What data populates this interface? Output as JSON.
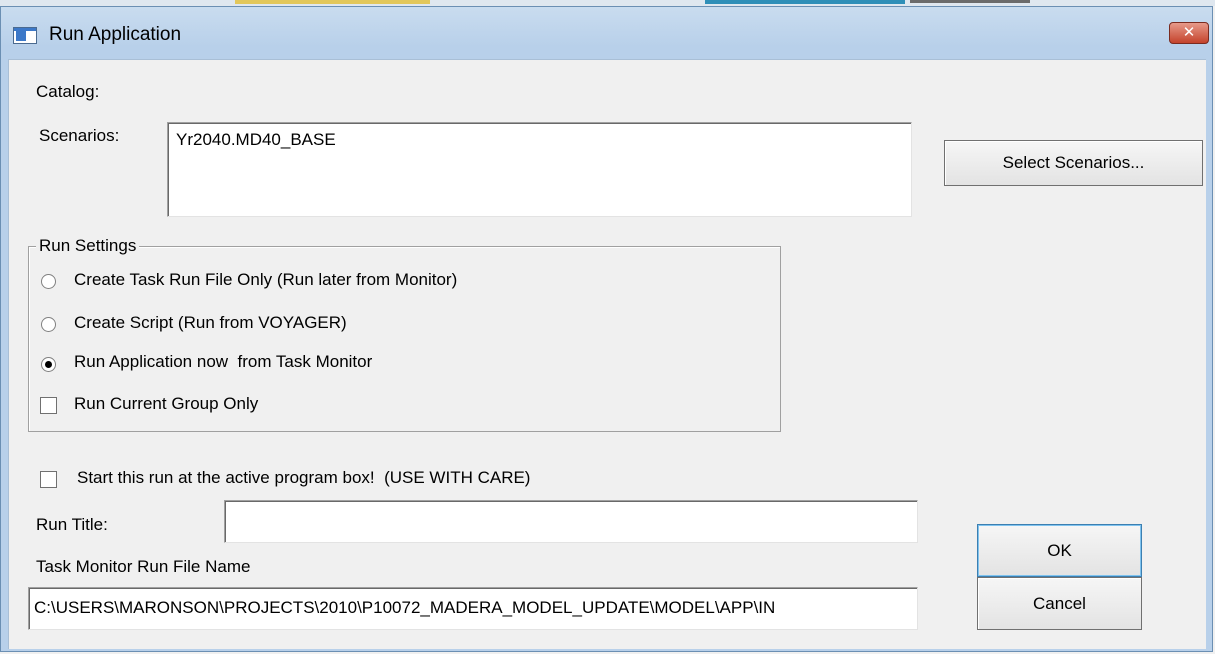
{
  "window": {
    "title": "Run Application",
    "close_glyph": "✕"
  },
  "catalog": {
    "label": "Catalog:"
  },
  "scenarios": {
    "label": "Scenarios:",
    "items": [
      "Yr2040.MD40_BASE"
    ],
    "select_button": "Select Scenarios..."
  },
  "run_settings": {
    "title": "Run Settings",
    "options": [
      {
        "label": "Create Task Run File Only (Run later from Monitor)",
        "checked": false
      },
      {
        "label": "Create Script (Run from VOYAGER)",
        "checked": false
      },
      {
        "label": "Run Application now  from Task Monitor",
        "checked": true
      }
    ],
    "current_group_only": {
      "label": "Run Current Group Only",
      "checked": false
    }
  },
  "start_active": {
    "label": "Start this run at the active program box!  (USE WITH CARE)",
    "checked": false
  },
  "run_title": {
    "label": "Run Title:",
    "value": ""
  },
  "run_file": {
    "label": "Task Monitor Run File Name",
    "value": "C:\\USERS\\MARONSON\\PROJECTS\\2010\\P10072_MADERA_MODEL_UPDATE\\MODEL\\APP\\IN"
  },
  "buttons": {
    "ok": "OK",
    "cancel": "Cancel"
  }
}
